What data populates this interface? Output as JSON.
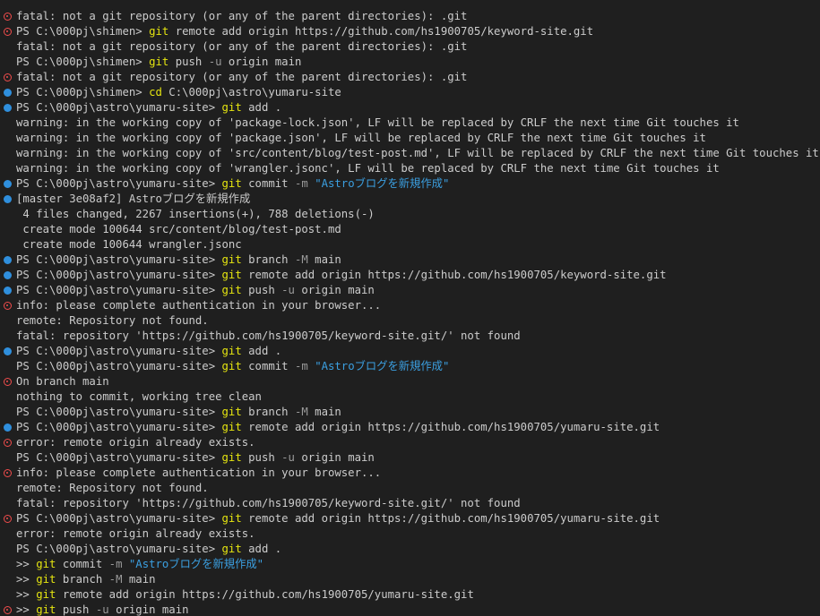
{
  "terminal": {
    "colors": {
      "background": "#1f1f1f",
      "text": "#cccccc",
      "command": "#e5e510",
      "flag": "#9a9a9a",
      "string": "#3b9fe0",
      "deco_success": "#2f8fdd",
      "deco_error": "#f14c4c"
    },
    "lines": [
      {
        "deco": "error",
        "segments": [
          {
            "t": "text",
            "v": "fatal: not a git repository (or any of the parent directories): .git"
          }
        ]
      },
      {
        "deco": "error",
        "segments": [
          {
            "t": "prompt",
            "v": "PS C:\\000pj\\shimen> "
          },
          {
            "t": "cmd",
            "v": "git"
          },
          {
            "t": "arg",
            "v": " remote add origin https://github.com/hs1900705/keyword-site.git"
          }
        ]
      },
      {
        "deco": "none",
        "segments": [
          {
            "t": "text",
            "v": "fatal: not a git repository (or any of the parent directories): .git"
          }
        ]
      },
      {
        "deco": "none",
        "segments": [
          {
            "t": "prompt",
            "v": "PS C:\\000pj\\shimen> "
          },
          {
            "t": "cmd",
            "v": "git"
          },
          {
            "t": "arg",
            "v": " push "
          },
          {
            "t": "flag",
            "v": "-u"
          },
          {
            "t": "arg",
            "v": " origin main"
          }
        ]
      },
      {
        "deco": "error",
        "segments": [
          {
            "t": "text",
            "v": "fatal: not a git repository (or any of the parent directories): .git"
          }
        ]
      },
      {
        "deco": "success",
        "segments": [
          {
            "t": "prompt",
            "v": "PS C:\\000pj\\shimen> "
          },
          {
            "t": "cmd",
            "v": "cd"
          },
          {
            "t": "arg",
            "v": " C:\\000pj\\astro\\yumaru-site"
          }
        ]
      },
      {
        "deco": "success",
        "segments": [
          {
            "t": "prompt",
            "v": "PS C:\\000pj\\astro\\yumaru-site> "
          },
          {
            "t": "cmd",
            "v": "git"
          },
          {
            "t": "arg",
            "v": " add ."
          }
        ]
      },
      {
        "deco": "none",
        "segments": [
          {
            "t": "text",
            "v": "warning: in the working copy of 'package-lock.json', LF will be replaced by CRLF the next time Git touches it"
          }
        ]
      },
      {
        "deco": "none",
        "segments": [
          {
            "t": "text",
            "v": "warning: in the working copy of 'package.json', LF will be replaced by CRLF the next time Git touches it"
          }
        ]
      },
      {
        "deco": "none",
        "segments": [
          {
            "t": "text",
            "v": "warning: in the working copy of 'src/content/blog/test-post.md', LF will be replaced by CRLF the next time Git touches it"
          }
        ]
      },
      {
        "deco": "none",
        "segments": [
          {
            "t": "text",
            "v": "warning: in the working copy of 'wrangler.jsonc', LF will be replaced by CRLF the next time Git touches it"
          }
        ]
      },
      {
        "deco": "success",
        "segments": [
          {
            "t": "prompt",
            "v": "PS C:\\000pj\\astro\\yumaru-site> "
          },
          {
            "t": "cmd",
            "v": "git"
          },
          {
            "t": "arg",
            "v": " commit "
          },
          {
            "t": "flag",
            "v": "-m"
          },
          {
            "t": "arg",
            "v": " "
          },
          {
            "t": "str",
            "v": "\"Astroブログを新規作成\""
          }
        ]
      },
      {
        "deco": "success",
        "segments": [
          {
            "t": "text",
            "v": "[master 3e08af2] Astroブログを新規作成"
          }
        ]
      },
      {
        "deco": "none",
        "segments": [
          {
            "t": "text",
            "v": " 4 files changed, 2267 insertions(+), 788 deletions(-)"
          }
        ]
      },
      {
        "deco": "none",
        "segments": [
          {
            "t": "text",
            "v": " create mode 100644 src/content/blog/test-post.md"
          }
        ]
      },
      {
        "deco": "none",
        "segments": [
          {
            "t": "text",
            "v": " create mode 100644 wrangler.jsonc"
          }
        ]
      },
      {
        "deco": "success",
        "segments": [
          {
            "t": "prompt",
            "v": "PS C:\\000pj\\astro\\yumaru-site> "
          },
          {
            "t": "cmd",
            "v": "git"
          },
          {
            "t": "arg",
            "v": " branch "
          },
          {
            "t": "flag",
            "v": "-M"
          },
          {
            "t": "arg",
            "v": " main"
          }
        ]
      },
      {
        "deco": "success",
        "segments": [
          {
            "t": "prompt",
            "v": "PS C:\\000pj\\astro\\yumaru-site> "
          },
          {
            "t": "cmd",
            "v": "git"
          },
          {
            "t": "arg",
            "v": " remote add origin https://github.com/hs1900705/keyword-site.git"
          }
        ]
      },
      {
        "deco": "success",
        "segments": [
          {
            "t": "prompt",
            "v": "PS C:\\000pj\\astro\\yumaru-site> "
          },
          {
            "t": "cmd",
            "v": "git"
          },
          {
            "t": "arg",
            "v": " push "
          },
          {
            "t": "flag",
            "v": "-u"
          },
          {
            "t": "arg",
            "v": " origin main"
          }
        ]
      },
      {
        "deco": "error",
        "segments": [
          {
            "t": "text",
            "v": "info: please complete authentication in your browser..."
          }
        ]
      },
      {
        "deco": "none",
        "segments": [
          {
            "t": "text",
            "v": "remote: Repository not found."
          }
        ]
      },
      {
        "deco": "none",
        "segments": [
          {
            "t": "text",
            "v": "fatal: repository 'https://github.com/hs1900705/keyword-site.git/' not found"
          }
        ]
      },
      {
        "deco": "success",
        "segments": [
          {
            "t": "prompt",
            "v": "PS C:\\000pj\\astro\\yumaru-site> "
          },
          {
            "t": "cmd",
            "v": "git"
          },
          {
            "t": "arg",
            "v": " add ."
          }
        ]
      },
      {
        "deco": "none",
        "segments": [
          {
            "t": "prompt",
            "v": "PS C:\\000pj\\astro\\yumaru-site> "
          },
          {
            "t": "cmd",
            "v": "git"
          },
          {
            "t": "arg",
            "v": " commit "
          },
          {
            "t": "flag",
            "v": "-m"
          },
          {
            "t": "arg",
            "v": " "
          },
          {
            "t": "str",
            "v": "\"Astroブログを新規作成\""
          }
        ]
      },
      {
        "deco": "error",
        "segments": [
          {
            "t": "text",
            "v": "On branch main"
          }
        ]
      },
      {
        "deco": "none",
        "segments": [
          {
            "t": "text",
            "v": "nothing to commit, working tree clean"
          }
        ]
      },
      {
        "deco": "none",
        "segments": [
          {
            "t": "prompt",
            "v": "PS C:\\000pj\\astro\\yumaru-site> "
          },
          {
            "t": "cmd",
            "v": "git"
          },
          {
            "t": "arg",
            "v": " branch "
          },
          {
            "t": "flag",
            "v": "-M"
          },
          {
            "t": "arg",
            "v": " main"
          }
        ]
      },
      {
        "deco": "success",
        "segments": [
          {
            "t": "prompt",
            "v": "PS C:\\000pj\\astro\\yumaru-site> "
          },
          {
            "t": "cmd",
            "v": "git"
          },
          {
            "t": "arg",
            "v": " remote add origin https://github.com/hs1900705/yumaru-site.git"
          }
        ]
      },
      {
        "deco": "error",
        "segments": [
          {
            "t": "text",
            "v": "error: remote origin already exists."
          }
        ]
      },
      {
        "deco": "none",
        "segments": [
          {
            "t": "prompt",
            "v": "PS C:\\000pj\\astro\\yumaru-site> "
          },
          {
            "t": "cmd",
            "v": "git"
          },
          {
            "t": "arg",
            "v": " push "
          },
          {
            "t": "flag",
            "v": "-u"
          },
          {
            "t": "arg",
            "v": " origin main"
          }
        ]
      },
      {
        "deco": "error",
        "segments": [
          {
            "t": "text",
            "v": "info: please complete authentication in your browser..."
          }
        ]
      },
      {
        "deco": "none",
        "segments": [
          {
            "t": "text",
            "v": "remote: Repository not found."
          }
        ]
      },
      {
        "deco": "none",
        "segments": [
          {
            "t": "text",
            "v": "fatal: repository 'https://github.com/hs1900705/keyword-site.git/' not found"
          }
        ]
      },
      {
        "deco": "error",
        "segments": [
          {
            "t": "prompt",
            "v": "PS C:\\000pj\\astro\\yumaru-site> "
          },
          {
            "t": "cmd",
            "v": "git"
          },
          {
            "t": "arg",
            "v": " remote add origin https://github.com/hs1900705/yumaru-site.git"
          }
        ]
      },
      {
        "deco": "none",
        "segments": [
          {
            "t": "text",
            "v": "error: remote origin already exists."
          }
        ]
      },
      {
        "deco": "none",
        "segments": [
          {
            "t": "prompt",
            "v": "PS C:\\000pj\\astro\\yumaru-site> "
          },
          {
            "t": "cmd",
            "v": "git"
          },
          {
            "t": "arg",
            "v": " add ."
          }
        ]
      },
      {
        "deco": "none",
        "segments": [
          {
            "t": "prompt",
            "v": ">> "
          },
          {
            "t": "cmd",
            "v": "git"
          },
          {
            "t": "arg",
            "v": " commit "
          },
          {
            "t": "flag",
            "v": "-m"
          },
          {
            "t": "arg",
            "v": " "
          },
          {
            "t": "str",
            "v": "\"Astroブログを新規作成\""
          }
        ]
      },
      {
        "deco": "none",
        "segments": [
          {
            "t": "prompt",
            "v": ">> "
          },
          {
            "t": "cmd",
            "v": "git"
          },
          {
            "t": "arg",
            "v": " branch "
          },
          {
            "t": "flag",
            "v": "-M"
          },
          {
            "t": "arg",
            "v": " main"
          }
        ]
      },
      {
        "deco": "none",
        "segments": [
          {
            "t": "prompt",
            "v": ">> "
          },
          {
            "t": "cmd",
            "v": "git"
          },
          {
            "t": "arg",
            "v": " remote add origin https://github.com/hs1900705/yumaru-site.git"
          }
        ]
      },
      {
        "deco": "error",
        "segments": [
          {
            "t": "prompt",
            "v": ">> "
          },
          {
            "t": "cmd",
            "v": "git"
          },
          {
            "t": "arg",
            "v": " push "
          },
          {
            "t": "flag",
            "v": "-u"
          },
          {
            "t": "arg",
            "v": " origin main"
          }
        ]
      }
    ]
  }
}
